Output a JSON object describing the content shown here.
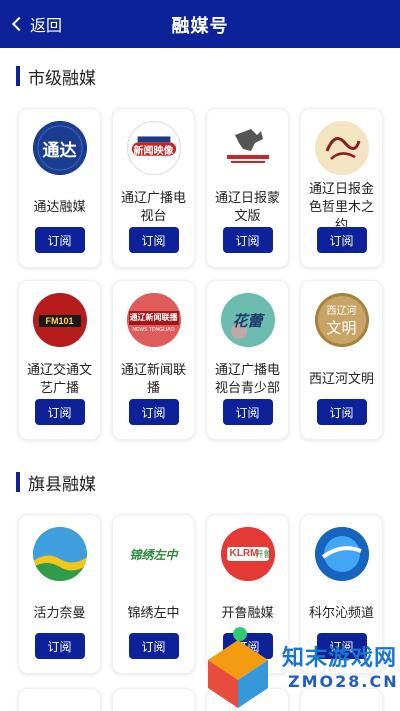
{
  "header": {
    "back_label": "返回",
    "title": "融媒号"
  },
  "sections": [
    {
      "title": "市级融媒",
      "items": [
        {
          "name": "通达融媒",
          "logo_text": "通达",
          "button": "订阅"
        },
        {
          "name": "通辽广播电视台",
          "logo_text": "新闻映像",
          "button": "订阅"
        },
        {
          "name": "通辽日报蒙文版",
          "logo_text": "",
          "button": "订阅"
        },
        {
          "name": "通辽日报金色哲里木之约",
          "logo_text": "",
          "button": "订阅"
        },
        {
          "name": "通辽交通文艺广播",
          "logo_text": "FM101",
          "button": "订阅"
        },
        {
          "name": "通辽新闻联播",
          "logo_text": "通辽新闻联播",
          "logo_sub": "NEWS TONGLIAO",
          "button": "订阅"
        },
        {
          "name": "通辽广播电视台青少部",
          "logo_text": "花蕾",
          "button": "订阅"
        },
        {
          "name": "西辽河文明",
          "logo_text": "西辽河",
          "logo_sub": "文明",
          "button": "订阅"
        }
      ]
    },
    {
      "title": "旗县融媒",
      "items": [
        {
          "name": "活力奈曼",
          "logo_text": "",
          "button": "订阅"
        },
        {
          "name": "锦绣左中",
          "logo_text": "锦绣左中",
          "button": "订阅"
        },
        {
          "name": "开鲁融媒",
          "logo_text": "KLRM",
          "logo_sub": "开鲁",
          "button": "订阅"
        },
        {
          "name": "科尔沁频道",
          "logo_text": "",
          "button": "订阅"
        }
      ]
    }
  ],
  "watermark": {
    "line1": "知末游戏网",
    "line2": "ZMO28.CN"
  },
  "colors": {
    "brand": "#0d2298",
    "text": "#222222"
  }
}
